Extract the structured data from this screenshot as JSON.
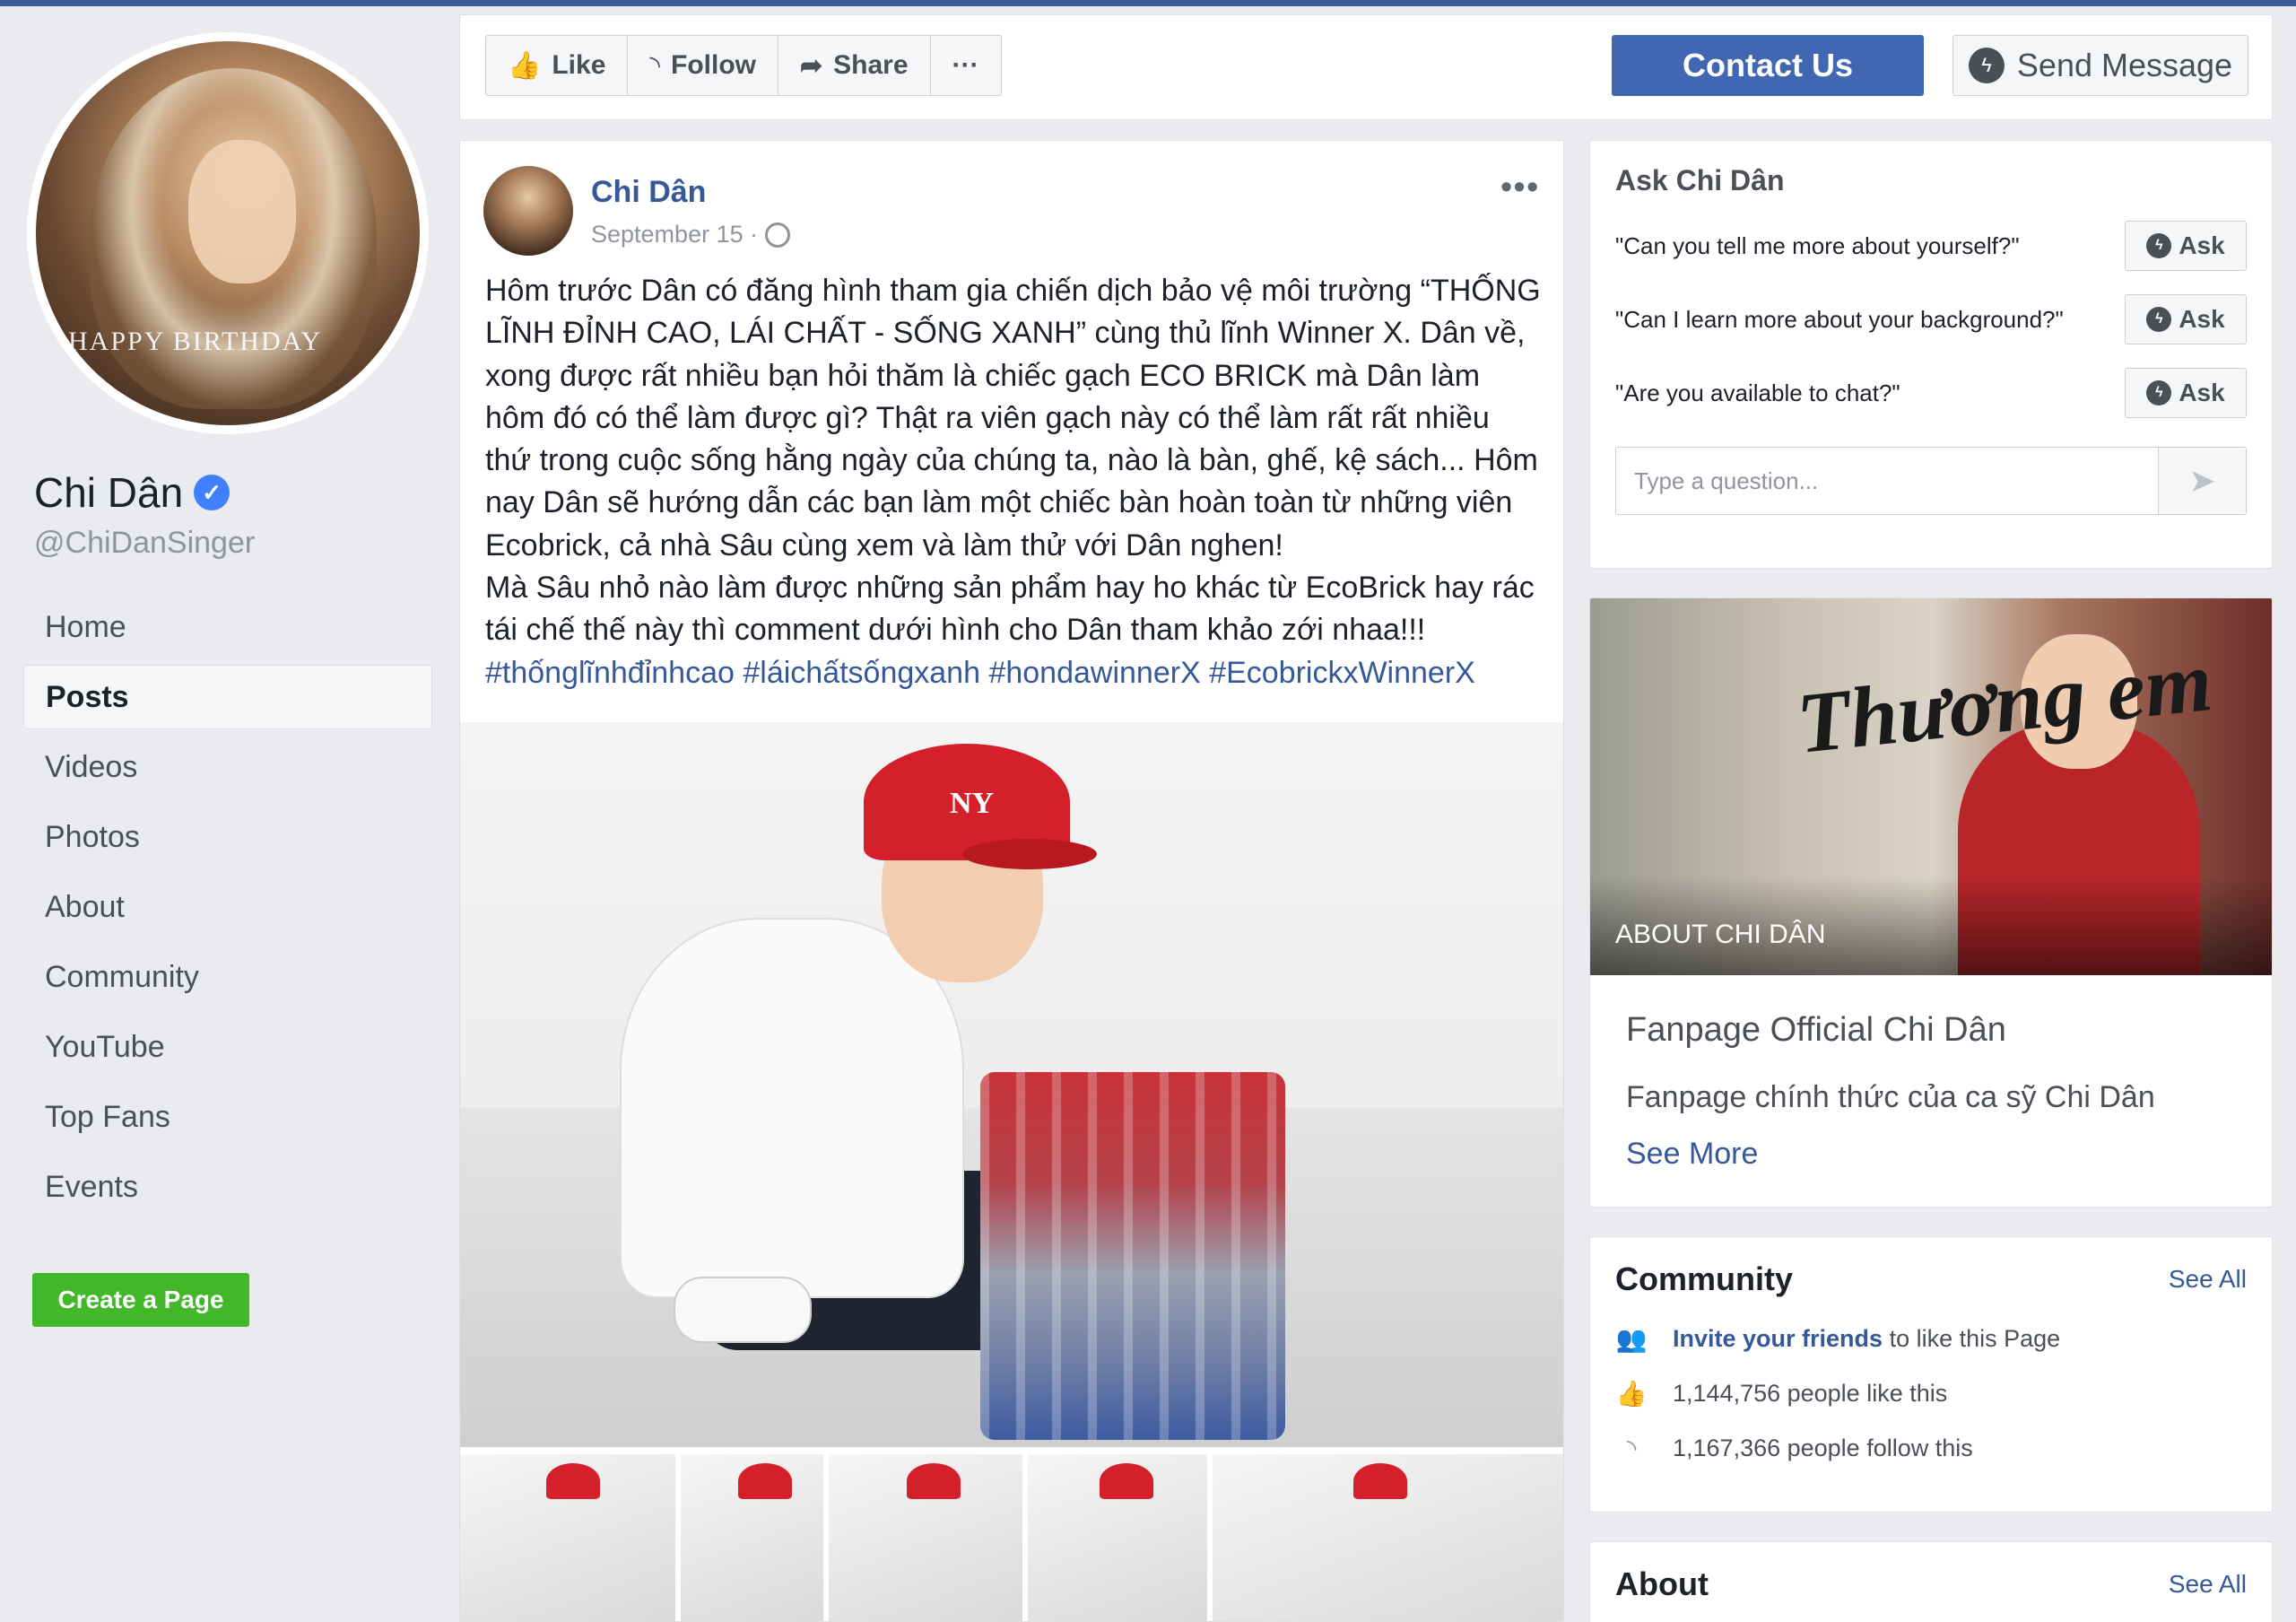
{
  "page": {
    "name": "Chi Dân",
    "handle": "@ChiDanSinger",
    "avatar_text": "HAPPY BIRTHDAY"
  },
  "nav": {
    "items": [
      {
        "label": "Home"
      },
      {
        "label": "Posts"
      },
      {
        "label": "Videos"
      },
      {
        "label": "Photos"
      },
      {
        "label": "About"
      },
      {
        "label": "Community"
      },
      {
        "label": "YouTube"
      },
      {
        "label": "Top Fans"
      },
      {
        "label": "Events"
      }
    ],
    "active": "Posts",
    "create_page": "Create a Page"
  },
  "actionbar": {
    "like": "Like",
    "follow": "Follow",
    "share": "Share",
    "more": "···",
    "contact": "Contact Us",
    "send_message": "Send Message"
  },
  "post": {
    "author": "Chi Dân",
    "date": "September 15 ·",
    "more": "•••",
    "text": "Hôm trước Dân có đăng hình tham gia chiến dịch bảo vệ môi trường “THỐNG LĨNH ĐỈNH CAO, LÁI CHẤT - SỐNG XANH” cùng thủ lĩnh Winner X. Dân về, xong được rất nhiều bạn hỏi thăm là chiếc gạch ECO BRICK mà Dân làm hôm đó có thể làm được gì? Thật ra viên gạch này có thể làm rất rất nhiều thứ trong cuộc sống hằng ngày của chúng ta, nào là bàn, ghế, kệ sách... Hôm nay Dân sẽ hướng dẫn các bạn làm một chiếc bàn hoàn toàn từ những viên Ecobrick, cả nhà Sâu cùng xem và làm thử với Dân nghen!\nMà Sâu nhỏ nào làm được những sản phẩm hay ho khác từ EcoBrick hay rác tái chế thế này thì comment dưới hình cho Dân tham khảo zới nhaa!!!",
    "hashtags": "#thốnglĩnhđỉnhcao #láichấtsốngxanh #hondawinnerX #EcobrickxWinnerX",
    "cap_logo": "NY"
  },
  "ask": {
    "title": "Ask Chi Dân",
    "questions": [
      {
        "q": "\"Can you tell me more about yourself?\"",
        "btn": "Ask"
      },
      {
        "q": "\"Can I learn more about your background?\"",
        "btn": "Ask"
      },
      {
        "q": "\"Are you available to chat?\"",
        "btn": "Ask"
      }
    ],
    "placeholder": "Type a question..."
  },
  "about_card": {
    "image_label": "ABOUT CHI DÂN",
    "image_script": "Thương em",
    "title": "Fanpage Official Chi Dân",
    "description": "Fanpage chính thức của ca sỹ Chi Dân",
    "see_more": "See More"
  },
  "community": {
    "title": "Community",
    "see_all": "See All",
    "invite_link": "Invite your friends",
    "invite_rest": " to like this Page",
    "likes": "1,144,756 people like this",
    "follows": "1,167,366 people follow this"
  },
  "about": {
    "title": "About",
    "see_all": "See All"
  }
}
